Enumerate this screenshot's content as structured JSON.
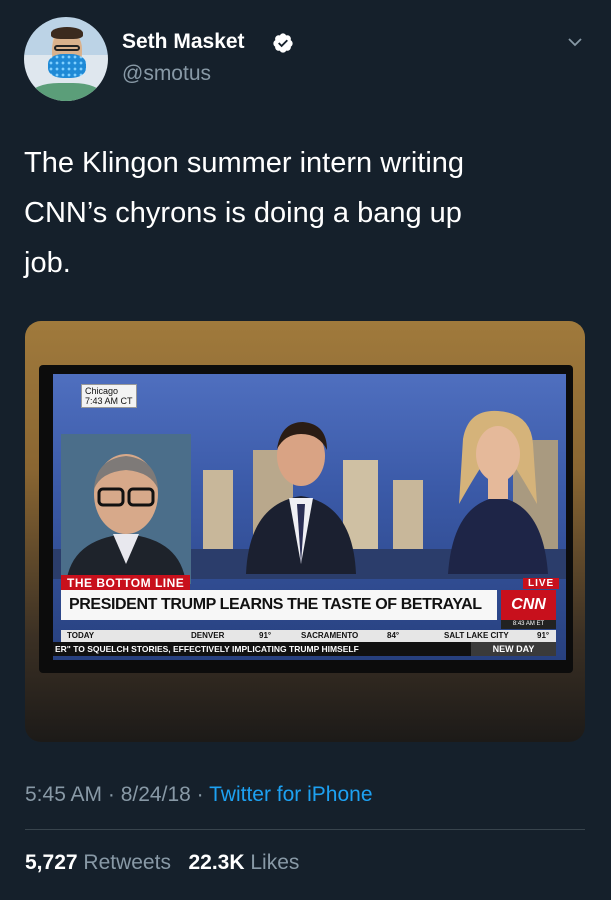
{
  "user": {
    "name": "Seth Masket",
    "handle": "@smotus"
  },
  "tweet": {
    "text_line1": "The Klingon summer intern writing",
    "text_line2": "CNN’s chyrons is doing a bang up",
    "text_line3": "job."
  },
  "media": {
    "location_city": "Chicago",
    "location_time": "7:43 AM CT",
    "segment_label": "THE BOTTOM LINE",
    "live_label": "LIVE",
    "headline": "PRESIDENT TRUMP LEARNS THE TASTE OF BETRAYAL",
    "network_logo": "CNN",
    "network_time": "8:43 AM ET",
    "weather": {
      "today": "TODAY",
      "city1": "DENVER",
      "temp1": "91°",
      "city2": "SACRAMENTO",
      "temp2": "84°",
      "city3": "SALT LAKE CITY",
      "temp3": "91°"
    },
    "ticker_text": "ER\" TO SQUELCH STORIES, EFFECTIVELY IMPLICATING TRUMP HIMSELF",
    "ticker_show": "NEW DAY"
  },
  "meta": {
    "time": "5:45 AM",
    "date": "8/24/18",
    "source": "Twitter for iPhone"
  },
  "stats": {
    "retweets_count": "5,727",
    "retweets_label": "Retweets",
    "likes_count": "22.3K",
    "likes_label": "Likes"
  },
  "colors": {
    "background": "#15202b",
    "secondary_text": "#8899a6",
    "link": "#1da1f2",
    "cnn_red": "#c8101c"
  },
  "icons": [
    "verified-badge-icon",
    "chevron-down-icon"
  ]
}
